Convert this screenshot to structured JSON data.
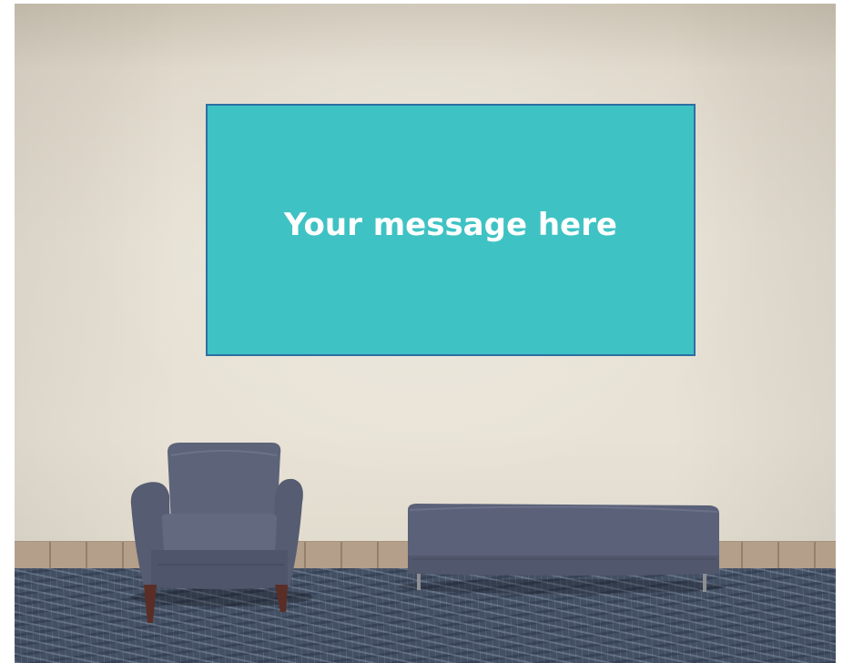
{
  "sign": {
    "message": "Your message here",
    "fill_color": "#3fc2c3",
    "border_color": "#2d6fa3"
  },
  "scene": {
    "furniture": [
      "armchair",
      "bench"
    ],
    "upholstery_color": "#5a6178",
    "wall_color": "#e6e0d3",
    "carpet_color": "#434f63"
  }
}
